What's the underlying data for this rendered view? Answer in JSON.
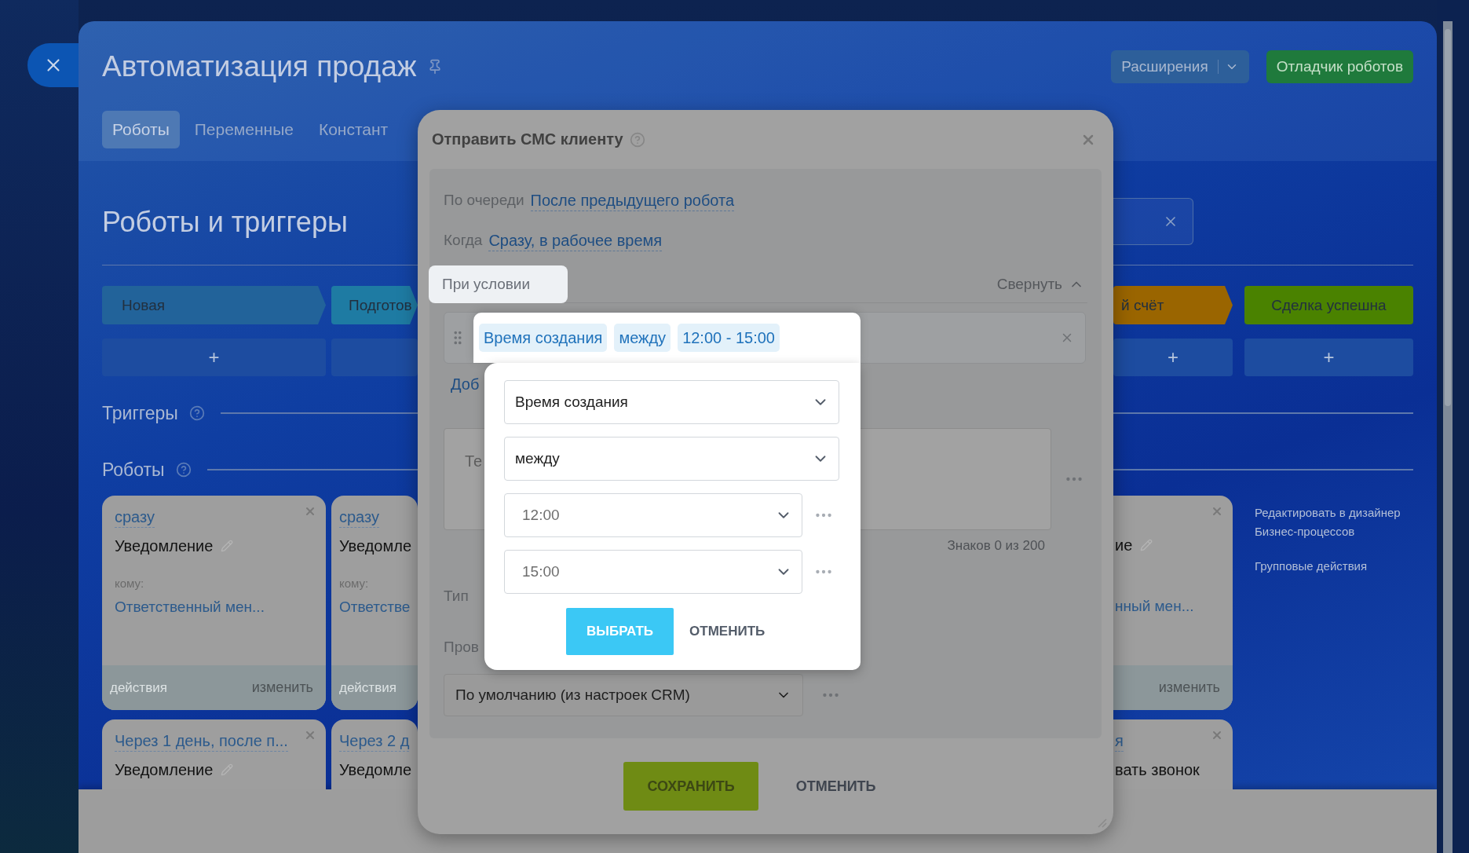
{
  "header": {
    "title": "Автоматизация продаж",
    "buttons": [
      {
        "label": "Расширения",
        "kind": "split"
      },
      {
        "label": "Отладчик роботов",
        "kind": "primary"
      }
    ],
    "tabs": [
      {
        "label": "Роботы",
        "selected": true
      },
      {
        "label": "Переменные",
        "selected": false
      },
      {
        "label": "Констант",
        "selected": false
      }
    ]
  },
  "board": {
    "title": "Роботы и триггеры",
    "stages": [
      {
        "label": "Новая",
        "color": "#22639a",
        "add": "+"
      },
      {
        "label": "Подготов",
        "color": "#1e7ba3"
      },
      {
        "label": "й счёт",
        "color": "#9a6500",
        "add": "+"
      },
      {
        "label": "Сделка успешна",
        "color": "#4a8200",
        "add": "+"
      }
    ],
    "sections": [
      "Триггеры",
      "Роботы"
    ],
    "cards": [
      [
        {
          "delay": "сразу",
          "name": "Уведомление",
          "editable": true,
          "to_label": "кому:",
          "to": "Ответственный мен...",
          "actions": "действия",
          "edit": "изменить",
          "closable": true
        },
        {
          "delay": "сразу",
          "name": "Уведомле",
          "editable": false,
          "to_label": "кому:",
          "to": "Ответстве",
          "actions": "действия",
          "closable": false
        },
        {
          "name": "ие",
          "editable": true,
          "to": "нный мен...",
          "edit": "изменить",
          "closable": true
        }
      ],
      [
        {
          "delay": "Через 1 день, после п...",
          "name": "Уведомление",
          "editable": true,
          "closable": true
        },
        {
          "delay": "Через 2 д",
          "name": "Уведомле",
          "editable": false,
          "closable": false
        },
        {
          "delay": "я",
          "name": "вать звонок",
          "editable": false,
          "closable": true
        }
      ]
    ],
    "side_links": [
      {
        "lines": [
          "Редактировать в дизайнер",
          "Бизнес-процессов"
        ]
      },
      {
        "lines": [
          "Групповые действия"
        ]
      }
    ]
  },
  "modal": {
    "title": "Отправить СМС клиенту",
    "fields": [
      {
        "label": "По очереди",
        "value": "После предыдущего робота"
      },
      {
        "label": "Когда",
        "value": "Сразу, в рабочее время"
      }
    ],
    "condition": {
      "label": "При условии",
      "toggle": "Свернуть"
    },
    "add_link": "Доб",
    "message": {
      "placeholder": "Те",
      "counter": "Знаков 0 из 200"
    },
    "labels": [
      "Тип",
      "Пров"
    ],
    "provider": {
      "value": "По умолчанию (из настроек CRM)"
    },
    "buttons": [
      {
        "label": "СОХРАНИТЬ",
        "kind": "primary"
      },
      {
        "label": "ОТМЕНИТЬ",
        "kind": "link"
      }
    ]
  },
  "popover": {
    "chips": [
      "Время создания",
      "между",
      "12:00 - 15:00"
    ],
    "selects": [
      {
        "value": "Время создания",
        "kind": "wide"
      },
      {
        "value": "между",
        "kind": "wide"
      },
      {
        "value": "12:00",
        "kind": "time"
      },
      {
        "value": "15:00",
        "kind": "time"
      }
    ],
    "buttons": [
      {
        "label": "ВЫБРАТЬ",
        "kind": "primary"
      },
      {
        "label": "ОТМЕНИТЬ",
        "kind": "link"
      }
    ]
  }
}
